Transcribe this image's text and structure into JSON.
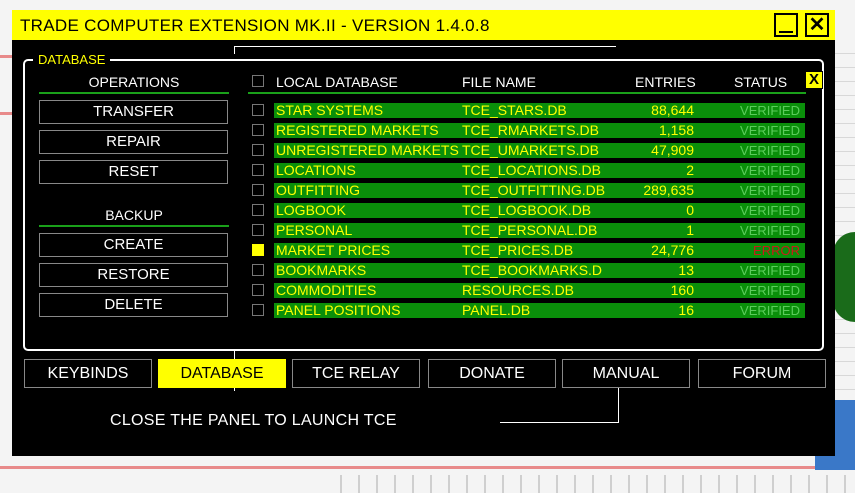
{
  "window": {
    "title": "TRADE COMPUTER EXTENSION MK.II - VERSION 1.4.0.8"
  },
  "panel": {
    "legend": "DATABASE",
    "close_label": "X"
  },
  "operations": {
    "title": "OPERATIONS",
    "buttons": [
      "TRANSFER",
      "REPAIR",
      "RESET"
    ]
  },
  "backup": {
    "title": "BACKUP",
    "buttons": [
      "CREATE",
      "RESTORE",
      "DELETE"
    ]
  },
  "table": {
    "headers": {
      "local_database": "LOCAL DATABASE",
      "file_name": "FILE NAME",
      "entries": "ENTRIES",
      "status": "STATUS"
    },
    "rows": [
      {
        "name": "STAR SYSTEMS",
        "file": "TCE_STARS.DB",
        "entries": "88,644",
        "status": "VERIFIED",
        "checked": false
      },
      {
        "name": "REGISTERED MARKETS",
        "file": "TCE_RMARKETS.DB",
        "entries": "1,158",
        "status": "VERIFIED",
        "checked": false
      },
      {
        "name": "UNREGISTERED MARKETS",
        "file": "TCE_UMARKETS.DB",
        "entries": "47,909",
        "status": "VERIFIED",
        "checked": false
      },
      {
        "name": "LOCATIONS",
        "file": "TCE_LOCATIONS.DB",
        "entries": "2",
        "status": "VERIFIED",
        "checked": false
      },
      {
        "name": "OUTFITTING",
        "file": "TCE_OUTFITTING.DB",
        "entries": "289,635",
        "status": "VERIFIED",
        "checked": false
      },
      {
        "name": "LOGBOOK",
        "file": "TCE_LOGBOOK.DB",
        "entries": "0",
        "status": "VERIFIED",
        "checked": false
      },
      {
        "name": "PERSONAL",
        "file": "TCE_PERSONAL.DB",
        "entries": "1",
        "status": "VERIFIED",
        "checked": false
      },
      {
        "name": "MARKET PRICES",
        "file": "TCE_PRICES.DB",
        "entries": "24,776",
        "status": "ERROR",
        "checked": true
      },
      {
        "name": "BOOKMARKS",
        "file": "TCE_BOOKMARKS.D",
        "entries": "13",
        "status": "VERIFIED",
        "checked": false
      },
      {
        "name": "COMMODITIES",
        "file": "RESOURCES.DB",
        "entries": "160",
        "status": "VERIFIED",
        "checked": false
      },
      {
        "name": "PANEL POSITIONS",
        "file": "PANEL.DB",
        "entries": "16",
        "status": "VERIFIED",
        "checked": false
      }
    ]
  },
  "tabs": [
    {
      "label": "KEYBINDS",
      "active": false
    },
    {
      "label": "DATABASE",
      "active": true
    },
    {
      "label": "TCE RELAY",
      "active": false
    },
    {
      "label": "DONATE",
      "active": false
    },
    {
      "label": "MANUAL",
      "active": false
    },
    {
      "label": "FORUM",
      "active": false
    }
  ],
  "footer": {
    "text": "CLOSE THE PANEL TO LAUNCH TCE"
  },
  "colors": {
    "accent": "#ffff00",
    "row_bg": "#0a8f0a",
    "verified": "#5ccc5c",
    "error": "#cc1a1a"
  }
}
